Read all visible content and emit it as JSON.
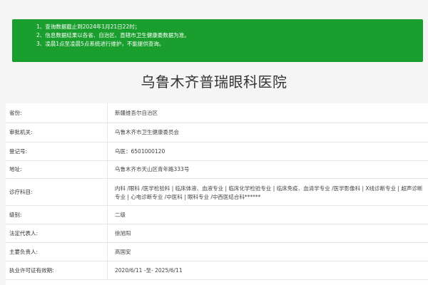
{
  "notice": {
    "lines": [
      "1、查询数据截止到2024年1月21日22时；",
      "2、信息数据结果以各省、自治区、直辖市卫生健康委数据为准。",
      "3、凌晨1点至凌晨5点系统进行维护，不能提供查询。"
    ]
  },
  "hospital_name": "乌鲁木齐普瑞眼科医院",
  "details": [
    {
      "label": "省份:",
      "value": "新疆维吾尔自治区"
    },
    {
      "label": "审批机关:",
      "value": "乌鲁木齐市卫生健康委员会"
    },
    {
      "label": "登记号:",
      "value": "乌医：6501000120"
    },
    {
      "label": "地址:",
      "value": "乌鲁木齐市天山区青年路333号"
    },
    {
      "label": "诊疗科目:",
      "value_lines": [
        "内科 /眼科 /医学检验科 | 临床体液、血液专业 | 临床化学检验专业 | 临床免疫、血清学专业 /医学影像科 | X线诊断专业 | 超声诊断",
        "专业 | 心电诊断专业 /中医科 | 眼科专业 /中西医结合科******"
      ]
    },
    {
      "label": "级别:",
      "value": "二级"
    },
    {
      "label": "法定代表人:",
      "value": "徐旭阳"
    },
    {
      "label": "主要负责人:",
      "value": "高国安"
    },
    {
      "label": "执业许可证有效期:",
      "value": "2020/6/11 -至- 2025/6/11"
    }
  ]
}
